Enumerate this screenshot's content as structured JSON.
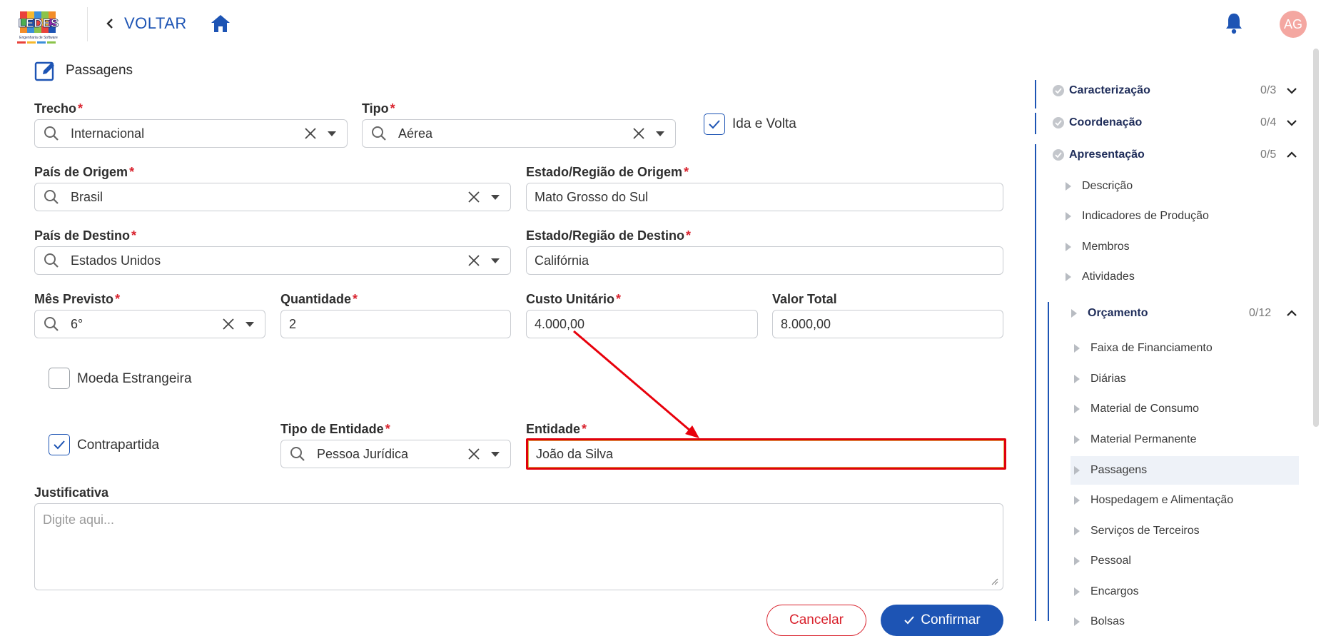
{
  "header": {
    "logo_text": "LEDES",
    "logo_subtitle": "Engenharia de Software",
    "back_label": "VOLTAR",
    "avatar_initials": "AG"
  },
  "form": {
    "section_title": "Passagens",
    "required_mark": "*",
    "trecho": {
      "label": "Trecho",
      "value": "Internacional"
    },
    "tipo": {
      "label": "Tipo",
      "value": "Aérea"
    },
    "ida_e_volta": {
      "label": "Ida e Volta",
      "checked": true
    },
    "pais_origem": {
      "label": "País de Origem",
      "value": "Brasil"
    },
    "estado_origem": {
      "label": "Estado/Região de Origem",
      "value": "Mato Grosso do Sul"
    },
    "pais_destino": {
      "label": "País de Destino",
      "value": "Estados Unidos"
    },
    "estado_destino": {
      "label": "Estado/Região de Destino",
      "value": "Califórnia"
    },
    "mes_previsto": {
      "label": "Mês Previsto",
      "value": "6°"
    },
    "quantidade": {
      "label": "Quantidade",
      "value": "2"
    },
    "custo_unitario": {
      "label": "Custo Unitário",
      "value": "4.000,00"
    },
    "valor_total": {
      "label": "Valor Total",
      "value": "8.000,00"
    },
    "moeda_estrangeira": {
      "label": "Moeda Estrangeira",
      "checked": false
    },
    "contrapartida": {
      "label": "Contrapartida",
      "checked": true
    },
    "tipo_entidade": {
      "label": "Tipo de Entidade",
      "value": "Pessoa Jurídica"
    },
    "entidade": {
      "label": "Entidade",
      "value": "João da Silva"
    },
    "justificativa": {
      "label": "Justificativa",
      "placeholder": "Digite aqui..."
    },
    "cancel_label": "Cancelar",
    "confirm_label": "Confirmar"
  },
  "sidebar": {
    "groups": [
      {
        "label": "Caracterização",
        "count": "0/3",
        "expanded": false
      },
      {
        "label": "Coordenação",
        "count": "0/4",
        "expanded": false
      },
      {
        "label": "Apresentação",
        "count": "0/5",
        "expanded": true
      }
    ],
    "apresentacao_items": [
      "Descrição",
      "Indicadores de Produção",
      "Membros",
      "Atividades"
    ],
    "orcamento": {
      "label": "Orçamento",
      "count": "0/12",
      "expanded": true
    },
    "orcamento_items": [
      "Faixa de Financiamento",
      "Diárias",
      "Material de Consumo",
      "Material Permanente",
      "Passagens",
      "Hospedagem e Alimentação",
      "Serviços de Terceiros",
      "Pessoal",
      "Encargos",
      "Bolsas"
    ],
    "active_item": "Passagens"
  },
  "colors": {
    "primary": "#1d54b4",
    "required": "#d9232e",
    "highlight": "#e0000b",
    "avatar_bg": "#f4a7a1"
  },
  "icons": [
    "chevron-left-icon",
    "home-icon",
    "bell-icon",
    "edit-icon",
    "search-icon",
    "clear-icon",
    "dropdown-icon",
    "check-icon",
    "check-circle-icon",
    "caret-right-icon",
    "chevron-down-icon",
    "chevron-up-icon"
  ]
}
